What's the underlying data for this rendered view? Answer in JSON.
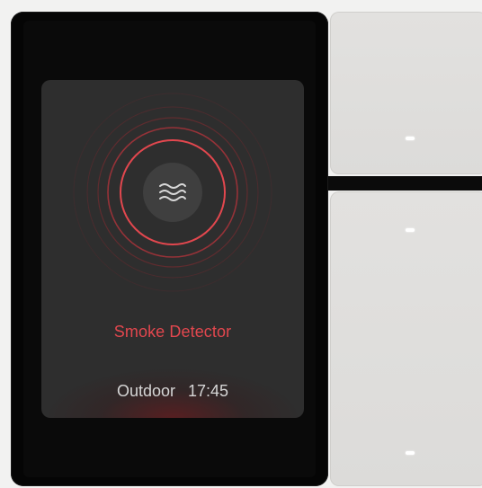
{
  "screen": {
    "title": "Smoke Detector",
    "location": "Outdoor",
    "time": "17:45",
    "icon": "smoke-waves-icon",
    "accent_color": "#e2474e"
  },
  "switches": [
    {
      "name": "top-switch",
      "indicator": "white-led"
    },
    {
      "name": "bottom-switch",
      "indicator": "white-led"
    }
  ]
}
